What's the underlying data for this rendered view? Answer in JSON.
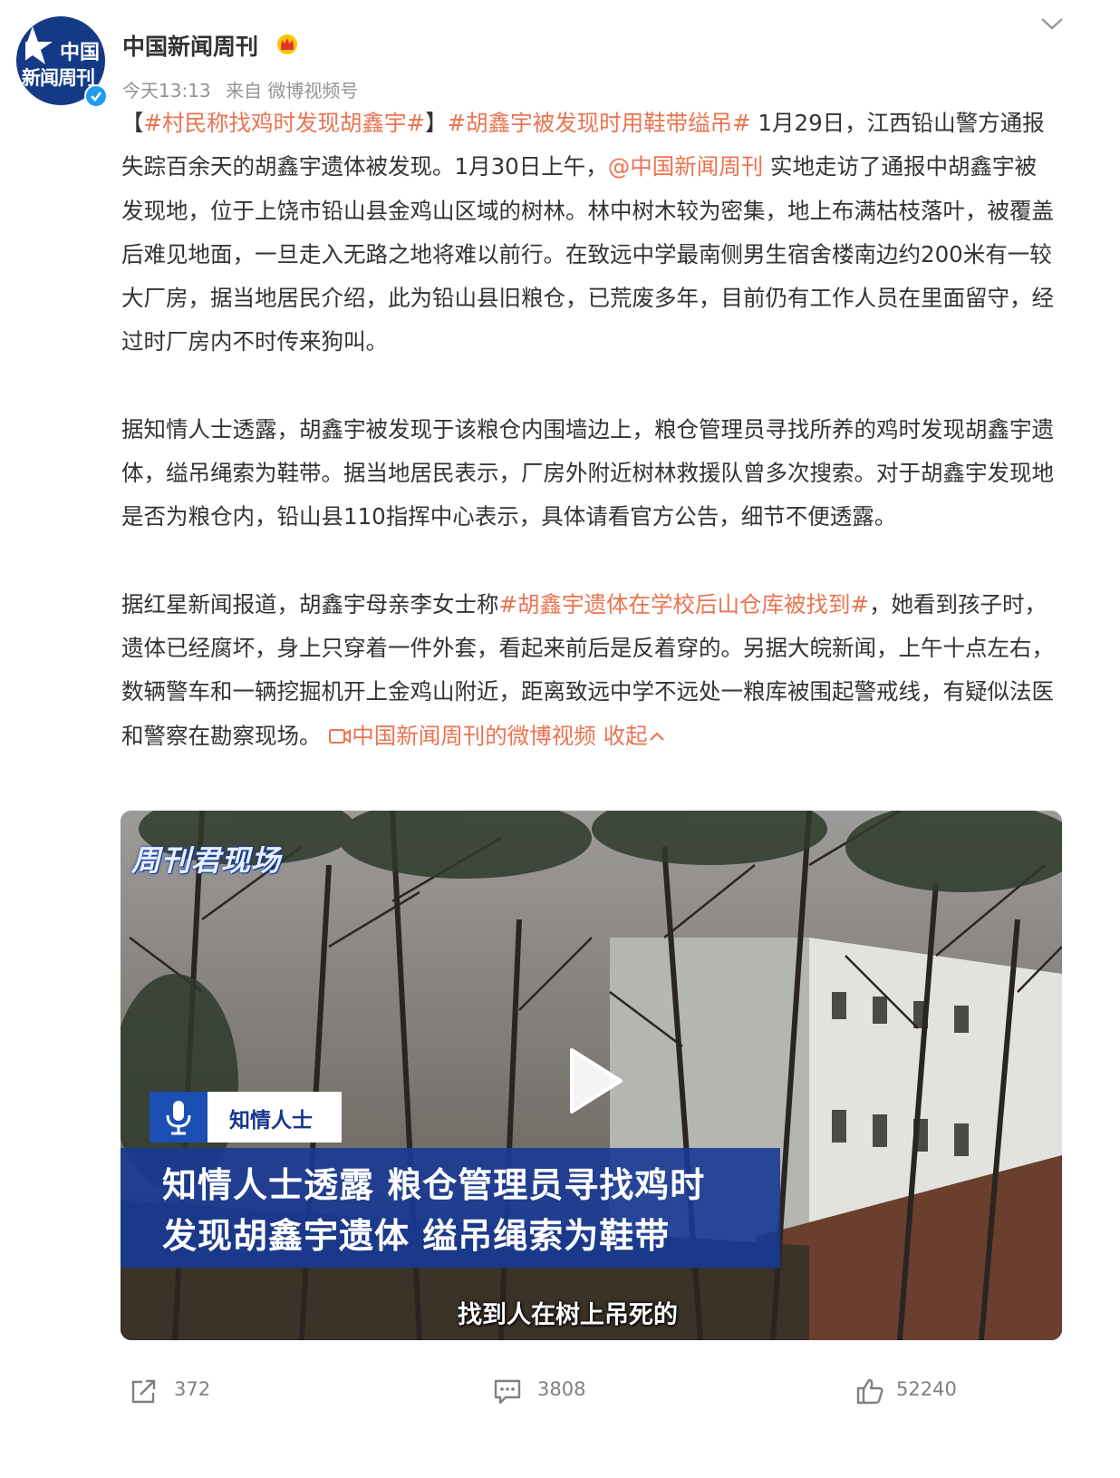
{
  "author": {
    "name": "中国新闻周刊",
    "avatar_text_1": "中国",
    "avatar_text_2": "新闻周刊"
  },
  "meta": {
    "time": "今天13:13",
    "source": "来自 微博视频号"
  },
  "post": {
    "p1_open": "【",
    "p1_tag1": "#村民称找鸡时发现胡鑫宇#",
    "p1_close": "】",
    "p1_tag2": "#胡鑫宇被发现时用鞋带缢吊#",
    "p1_text1": " 1月29日，江西铅山警方通报失踪百余天的胡鑫宇遗体被发现。1月30日上午，",
    "p1_mention": "@中国新闻周刊",
    "p1_text2": " 实地走访了通报中胡鑫宇被发现地，位于上饶市铅山县金鸡山区域的树林。林中树木较为密集，地上布满枯枝落叶，被覆盖后难见地面，一旦走入无路之地将难以前行。在致远中学最南侧男生宿舍楼南边约200米有一较大厂房，据当地居民介绍，此为铅山县旧粮仓，已荒废多年，目前仍有工作人员在里面留守，经过时厂房内不时传来狗叫。",
    "p2": "据知情人士透露，胡鑫宇被发现于该粮仓内围墙边上，粮仓管理员寻找所养的鸡时发现胡鑫宇遗体，缢吊绳索为鞋带。据当地居民表示，厂房外附近树林救援队曾多次搜索。对于胡鑫宇发现地是否为粮仓内，铅山县110指挥中心表示，具体请看官方公告，细节不便透露。",
    "p3_text1": "据红星新闻报道，胡鑫宇母亲李女士称",
    "p3_tag": "#胡鑫宇遗体在学校后山仓库被找到#",
    "p3_text2": "，她看到孩子时，遗体已经腐坏，身上只穿着一件外套，看起来前后是反着穿的。另据大皖新闻，上午十点左右，数辆警车和一辆挖掘机开上金鸡山附近，距离致远中学不远处一粮库被围起警戒线，有疑似法医和警察在勘察现场。",
    "video_link": "中国新闻周刊的微博视频",
    "collapse": "收起"
  },
  "video": {
    "logo": "周刊君现场",
    "speaker": "知情人士",
    "caption_line1": "知情人士透露 粮仓管理员寻找鸡时",
    "caption_line2": "发现胡鑫宇遗体 缢吊绳索为鞋带",
    "subtitle": "找到人在树上吊死的"
  },
  "actions": {
    "reposts": "372",
    "comments": "3808",
    "likes": "52240"
  },
  "colors": {
    "link": "#eb7350",
    "verified": "#1f9bf0",
    "caption_bg": "#183a96"
  }
}
